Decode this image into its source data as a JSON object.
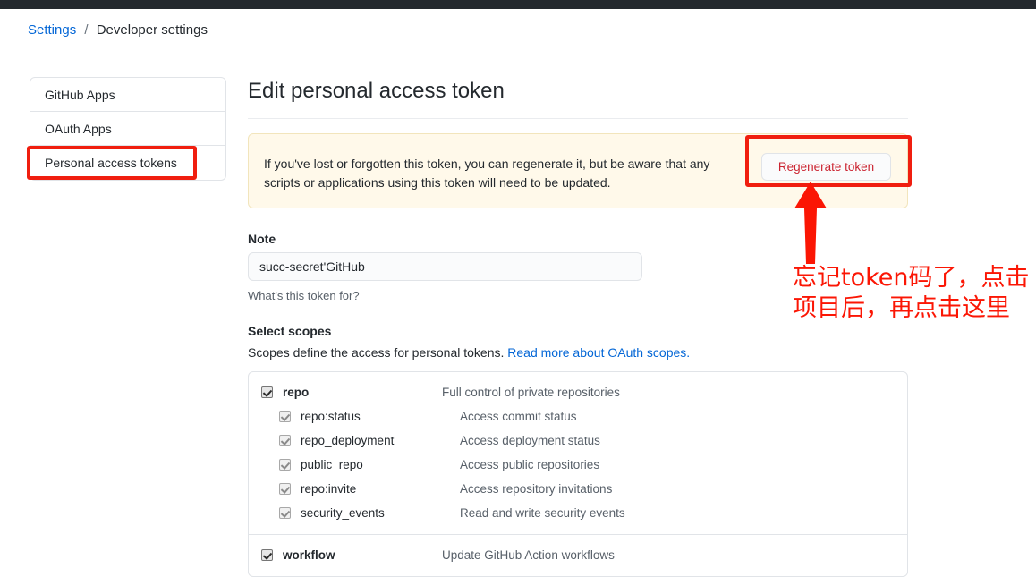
{
  "topbar": {
    "color": "#24292e"
  },
  "breadcrumb": {
    "root_label": "Settings",
    "separator": "/",
    "current_label": "Developer settings"
  },
  "sidebar": {
    "items": [
      {
        "label": "GitHub Apps",
        "selected": false
      },
      {
        "label": "OAuth Apps",
        "selected": false
      },
      {
        "label": "Personal access tokens",
        "selected": true
      }
    ]
  },
  "main": {
    "page_title": "Edit personal access token",
    "warning": {
      "text": "If you've lost or forgotten this token, you can regenerate it, but be aware that any scripts or applications using this token will need to be updated.",
      "button_label": "Regenerate token",
      "background": "#fff9ea",
      "button_text_color": "#cb2431"
    },
    "note": {
      "label": "Note",
      "value": "succ-secret'GitHub",
      "placeholder": "What's this token for?",
      "hint": "What's this token for?"
    },
    "scopes": {
      "title": "Select scopes",
      "description_prefix": "Scopes define the access for personal tokens. ",
      "description_link": "Read more about OAuth scopes.",
      "groups": [
        {
          "name": "repo",
          "description": "Full control of private repositories",
          "checked": true,
          "enabled": true,
          "children": [
            {
              "name": "repo:status",
              "description": "Access commit status",
              "checked": true,
              "enabled": false
            },
            {
              "name": "repo_deployment",
              "description": "Access deployment status",
              "checked": true,
              "enabled": false
            },
            {
              "name": "public_repo",
              "description": "Access public repositories",
              "checked": true,
              "enabled": false
            },
            {
              "name": "repo:invite",
              "description": "Access repository invitations",
              "checked": true,
              "enabled": false
            },
            {
              "name": "security_events",
              "description": "Read and write security events",
              "checked": true,
              "enabled": false
            }
          ]
        },
        {
          "name": "workflow",
          "description": "Update GitHub Action workflows",
          "checked": true,
          "enabled": true,
          "children": []
        }
      ]
    }
  },
  "annotations": {
    "color": "#fb1604",
    "note_text": "忘记token码了，点击项目后，再点击这里",
    "highlight_sidebar_target": "Personal access tokens",
    "highlight_button_target": "Regenerate token"
  }
}
